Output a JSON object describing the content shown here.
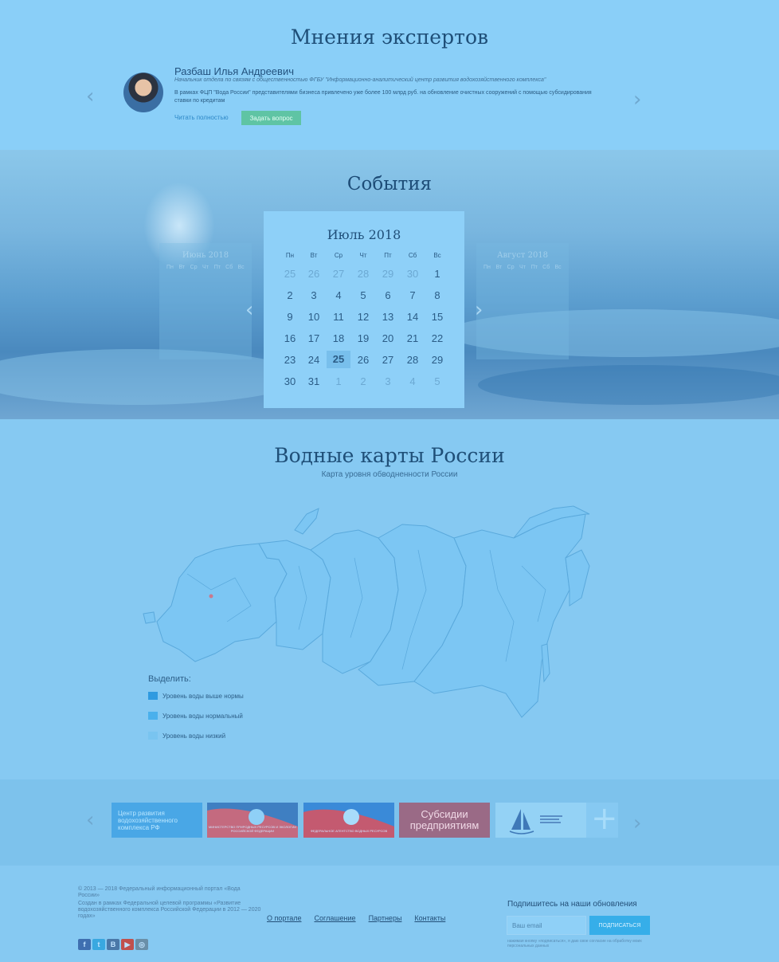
{
  "experts": {
    "title": "Мнения экспертов",
    "name": "Разбаш Илья Андреевич",
    "position": "Начальник отдела по связям с общественностью ФГБУ \"Информационно-аналитический центр развития водохозяйственного комплекса\"",
    "quote": "В рамках ФЦП \"Вода России\" представителями бизнеса привлечено уже более 100 млрд руб. на обновление очистных сооружений с помощью субсидирования ставки по кредитам",
    "read_more": "Читать полностью",
    "ask_button": "Задать вопрос",
    "prev": "‹",
    "next": "›"
  },
  "events": {
    "title": "События",
    "prev": "‹",
    "next": "›",
    "prev_month": "Июнь 2018",
    "next_month": "Август 2018",
    "month_title": "Июль 2018",
    "weekdays": [
      "Пн",
      "Вт",
      "Ср",
      "Чт",
      "Пт",
      "Сб",
      "Вс"
    ],
    "mini_weekdays": [
      "Пн",
      "Вт",
      "Ср",
      "Чт",
      "Пт",
      "Сб",
      "Вс"
    ],
    "weeks": [
      [
        "25",
        "26",
        "27",
        "28",
        "29",
        "30",
        "1"
      ],
      [
        "2",
        "3",
        "4",
        "5",
        "6",
        "7",
        "8"
      ],
      [
        "9",
        "10",
        "11",
        "12",
        "13",
        "14",
        "15"
      ],
      [
        "16",
        "17",
        "18",
        "19",
        "20",
        "21",
        "22"
      ],
      [
        "23",
        "24",
        "25",
        "26",
        "27",
        "28",
        "29"
      ],
      [
        "30",
        "31",
        "1",
        "2",
        "3",
        "4",
        "5"
      ]
    ],
    "today": "25"
  },
  "maps": {
    "title": "Водные карты России",
    "subtitle": "Карта уровня обводненности России",
    "legend_title": "Выделить:",
    "legend": [
      {
        "label": "Уровень воды выше нормы",
        "color": "#2f9ae0"
      },
      {
        "label": "Уровень воды нормальный",
        "color": "#4ab0ec"
      },
      {
        "label": "Уровень воды низкий",
        "color": "#79c4f0"
      }
    ]
  },
  "partners": {
    "prev": "‹",
    "next": "›",
    "banner1": "Центр развития водохозяйственного комплекса РФ",
    "banner2_caption": "МИНИСТЕРСТВО ПРИРОДНЫХ РЕСУРСОВ И ЭКОЛОГИИ РОССИЙСКОЙ ФЕДЕРАЦИИ",
    "banner3_caption": "ФЕДЕРАЛЬНОЕ АГЕНТСТВО ВОДНЫХ РЕСУРСОВ",
    "banner4": "Субсидии предприятиям",
    "banner6": "+"
  },
  "footer": {
    "copyright": "© 2013 — 2018 Федеральный информационный портал «Вода России»",
    "program": "Создан в рамках Федеральной целевой программы «Развитие водохозяйственного комплекса Российской Федерации в 2012 — 2020 годах»",
    "nav": [
      "О портале",
      "Соглашение",
      "Партнеры",
      "Контакты"
    ],
    "socials": [
      "f",
      "t",
      "B",
      "▶",
      "◎"
    ],
    "subscribe_title": "Подпишитесь на наши обновления",
    "email_placeholder": "Ваш email",
    "subscribe_button": "ПОДПИСАТЬСЯ",
    "subscribe_note": "нажимая кнопку «подписаться», я даю свое согласие на обработку моих персональных данных"
  }
}
